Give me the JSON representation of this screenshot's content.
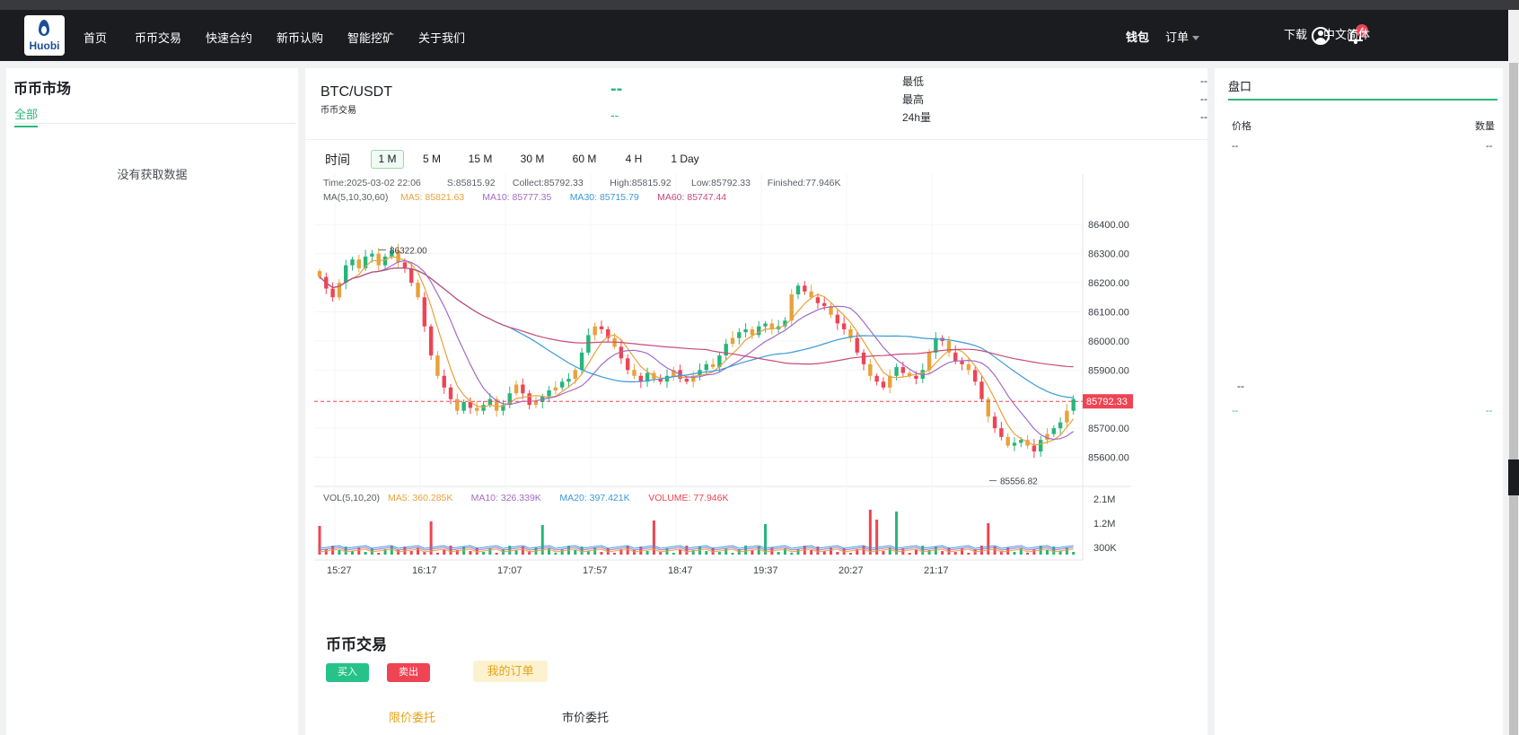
{
  "nav": {
    "logo_text": "Huobi",
    "items": [
      "首页",
      "币币交易",
      "快速合约",
      "新币认购",
      "智能挖矿",
      "关于我们"
    ],
    "wallet": "钱包",
    "orders": "订单",
    "notification_count": "4",
    "download": "下载",
    "language": "中文简体"
  },
  "market": {
    "title": "币币市场",
    "tab_all": "全部",
    "empty": "没有获取数据"
  },
  "ticker": {
    "pair": "BTC/USDT",
    "type": "币币交易",
    "price": "--",
    "change": "--",
    "stats": [
      {
        "label": "最低",
        "value": "--"
      },
      {
        "label": "最高",
        "value": "--"
      },
      {
        "label": "24h量",
        "value": "--"
      }
    ]
  },
  "timeframes": {
    "label": "时间",
    "options": [
      "1 M",
      "5 M",
      "15 M",
      "30 M",
      "60 M",
      "4 H",
      "1 Day"
    ],
    "active": "1 M"
  },
  "chart_data": {
    "type": "candlestick",
    "info_line": [
      "Time:2025-03-02 22:06",
      "S:85815.92",
      "Collect:85792.33",
      "High:85815.92",
      "Low:85792.33",
      "Finished:77.946K"
    ],
    "ma_line": {
      "label": "MA(5,10,30,60)",
      "items": [
        {
          "text": "MA5: 85821.63",
          "color": "#e8a23c"
        },
        {
          "text": "MA10: 85777.35",
          "color": "#a36bc7"
        },
        {
          "text": "MA30: 85715.79",
          "color": "#3a9ad9"
        },
        {
          "text": "MA60: 85747.44",
          "color": "#c74a7a"
        }
      ]
    },
    "price_axis": [
      "86400.00",
      "86300.00",
      "86200.00",
      "86100.00",
      "86000.00",
      "85900.00",
      "85800.00",
      "85700.00",
      "85600.00"
    ],
    "ylim": [
      85500,
      86450
    ],
    "current_price": "85792.33",
    "max_marker": "86322.00",
    "min_marker": "85556.82",
    "time_axis": [
      "15:27",
      "16:17",
      "17:07",
      "17:57",
      "18:47",
      "19:37",
      "20:27",
      "21:17"
    ],
    "close_series": [
      86220,
      86180,
      86150,
      86200,
      86260,
      86280,
      86250,
      86290,
      86300,
      86260,
      86290,
      86310,
      86270,
      86250,
      86200,
      86150,
      86050,
      85950,
      85880,
      85840,
      85800,
      85760,
      85790,
      85770,
      85760,
      85780,
      85800,
      85760,
      85780,
      85820,
      85850,
      85820,
      85780,
      85790,
      85810,
      85830,
      85840,
      85860,
      85870,
      85900,
      85960,
      86020,
      86050,
      86040,
      86010,
      85980,
      85940,
      85900,
      85880,
      85860,
      85890,
      85870,
      85860,
      85880,
      85900,
      85870,
      85860,
      85880,
      85900,
      85920,
      85910,
      85950,
      85990,
      86010,
      86030,
      86040,
      86020,
      86050,
      86060,
      86040,
      86050,
      86070,
      86160,
      86190,
      86170,
      86150,
      86130,
      86120,
      86090,
      86060,
      86040,
      86010,
      85960,
      85920,
      85880,
      85860,
      85840,
      85880,
      85910,
      85890,
      85880,
      85870,
      85900,
      85960,
      86010,
      86000,
      85960,
      85930,
      85920,
      85900,
      85860,
      85800,
      85740,
      85700,
      85670,
      85640,
      85650,
      85660,
      85640,
      85620,
      85660,
      85680,
      85700,
      85720,
      85760,
      85800
    ],
    "volume": {
      "label": "VOL(5,10,20)",
      "items": [
        {
          "text": "MA5: 360.285K",
          "color": "#e8a23c"
        },
        {
          "text": "MA10: 326.339K",
          "color": "#a36bc7"
        },
        {
          "text": "MA20: 397.421K",
          "color": "#3a9ad9"
        },
        {
          "text": "VOLUME: 77.946K",
          "color": "#ee4454"
        }
      ],
      "axis": [
        "2.1M",
        "1.2M",
        "300K"
      ]
    }
  },
  "trade": {
    "title": "币币交易",
    "buy": "买入",
    "sell": "卖出",
    "my_orders": "我的订单",
    "tab_limit": "限价委托",
    "tab_market": "市价委托"
  },
  "orderbook": {
    "title": "盘口",
    "col_price": "价格",
    "col_amount": "数量",
    "dash": "--"
  }
}
